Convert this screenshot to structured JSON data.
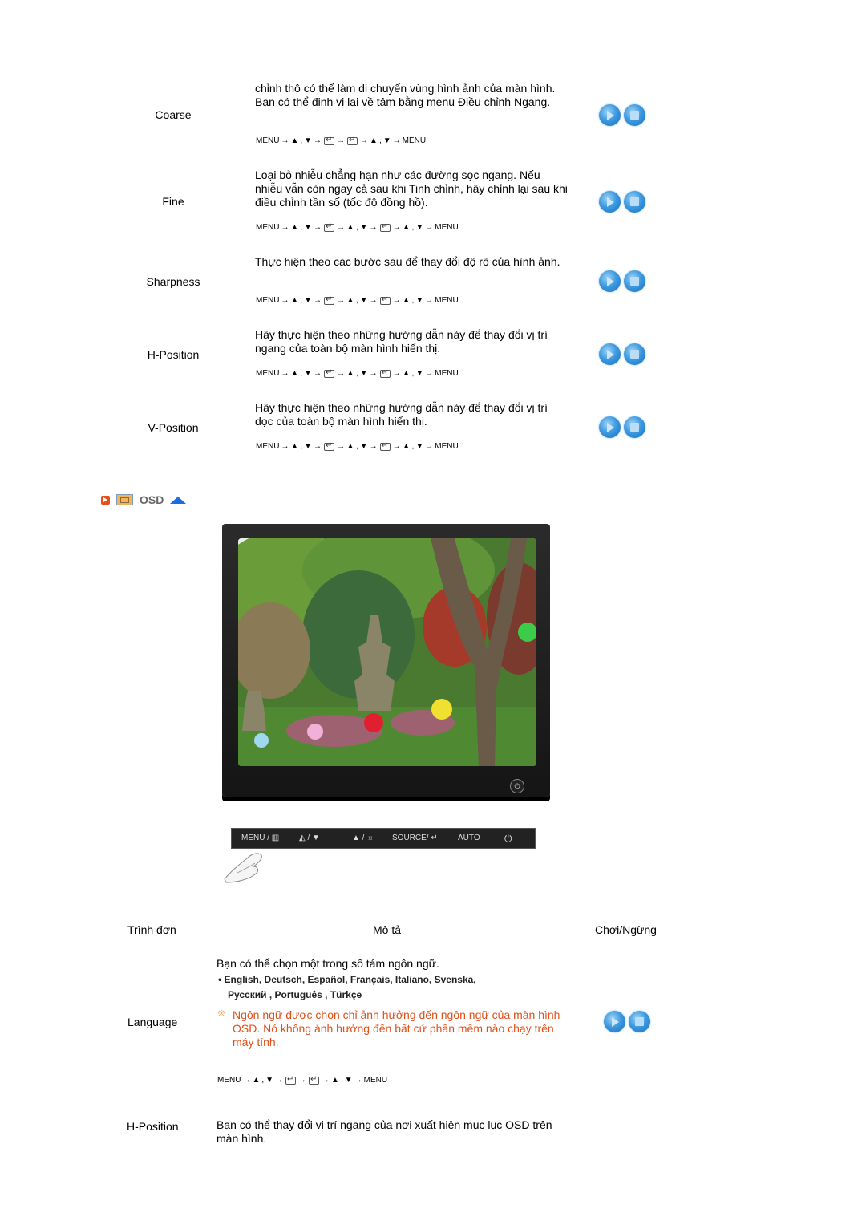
{
  "picture_rows": [
    {
      "name": "Coarse",
      "description": "chỉnh thô có thể làm di chuyển vùng hình ảnh của màn hình. Bạn có thể định vị lại về tâm bằng menu Điều chỉnh Ngang.",
      "sequence": [
        "MENU",
        "→",
        "▲",
        ",",
        "▼",
        "→",
        "[enter]",
        "→",
        "[enter]",
        "→",
        "▲",
        ",",
        "▼",
        "→",
        "MENU"
      ]
    },
    {
      "name": "Fine",
      "description": "Loại bỏ nhiễu chẳng hạn như các đường sọc ngang. Nếu nhiễu vẫn còn ngay cả sau khi Tinh chỉnh, hãy chỉnh lại sau khi điều chỉnh tần số (tốc độ đồng hồ).",
      "sequence": [
        "MENU",
        "→",
        "▲",
        ",",
        "▼",
        "→",
        "[enter]",
        "→",
        "▲",
        ",",
        "▼",
        "→",
        "[enter]",
        "→",
        "▲",
        ",",
        "▼",
        "→",
        "MENU"
      ]
    },
    {
      "name": "Sharpness",
      "description": "Thực hiện theo các bước sau để thay đổi độ rõ của hình ảnh.",
      "sequence": [
        "MENU",
        "→",
        "▲",
        ",",
        "▼",
        "→",
        "[enter]",
        "→",
        "▲",
        ",",
        "▼",
        "→",
        "[enter]",
        "→",
        "▲",
        ",",
        "▼",
        "→",
        "MENU"
      ]
    },
    {
      "name": "H-Position",
      "description": "Hãy thực hiện theo những hướng dẫn này để thay đổi vị trí ngang của toàn bộ màn hình hiển thị.",
      "sequence": [
        "MENU",
        "→",
        "▲",
        ",",
        "▼",
        "→",
        "[enter]",
        "→",
        "▲",
        ",",
        "▼",
        "→",
        "[enter]",
        "→",
        "▲",
        ",",
        "▼",
        "→",
        "MENU"
      ]
    },
    {
      "name": "V-Position",
      "description": "Hãy thực hiện theo những hướng dẫn này để thay đổi vị trí dọc của toàn bộ màn hình hiển thị.",
      "sequence": [
        "MENU",
        "→",
        "▲",
        ",",
        "▼",
        "→",
        "[enter]",
        "→",
        "▲",
        ",",
        "▼",
        "→",
        "[enter]",
        "→",
        "▲",
        ",",
        "▼",
        "→",
        "MENU"
      ]
    }
  ],
  "osd_section": {
    "title": "OSD",
    "icons": [
      "play-marker-icon",
      "osd-menu-icon",
      "up-arrow-icon"
    ]
  },
  "osd_bar": {
    "menu": "MENU / ▥",
    "magic": "◭ / ▼",
    "bright": "▲ / ☼",
    "source": "SOURCE/ ↵",
    "auto": "AUTO",
    "power": "⏻"
  },
  "monitor": {
    "power": "⏻"
  },
  "table_header": {
    "menu": "Trình đơn",
    "description": "Mô tả",
    "play_stop": "Chơi/Ngừng"
  },
  "language_row": {
    "name": "Language",
    "intro": "Bạn có thể chọn một trong số tám ngôn ngữ.",
    "languages_line1": "• English, Deutsch, Español, Français,  Italiano, Svenska,",
    "languages_line2": "Русский , Português , Türkçe",
    "note_symbol": "※",
    "note": "Ngôn ngữ được chọn chỉ ảnh hưởng đến ngôn ngữ của màn hình OSD. Nó không ảnh hưởng đến bất cứ phần mềm nào chạy trên máy tính.",
    "sequence": [
      "MENU",
      "→",
      "▲",
      ",",
      "▼",
      "→",
      "[enter]",
      "→",
      "[enter]",
      "→",
      "▲",
      ",",
      "▼",
      "→",
      "MENU"
    ]
  },
  "hposition_row": {
    "name": "H-Position",
    "description": "Bạn có thể thay đổi vị trí ngang của nơi xuất hiện mục lục OSD trên màn hình."
  }
}
